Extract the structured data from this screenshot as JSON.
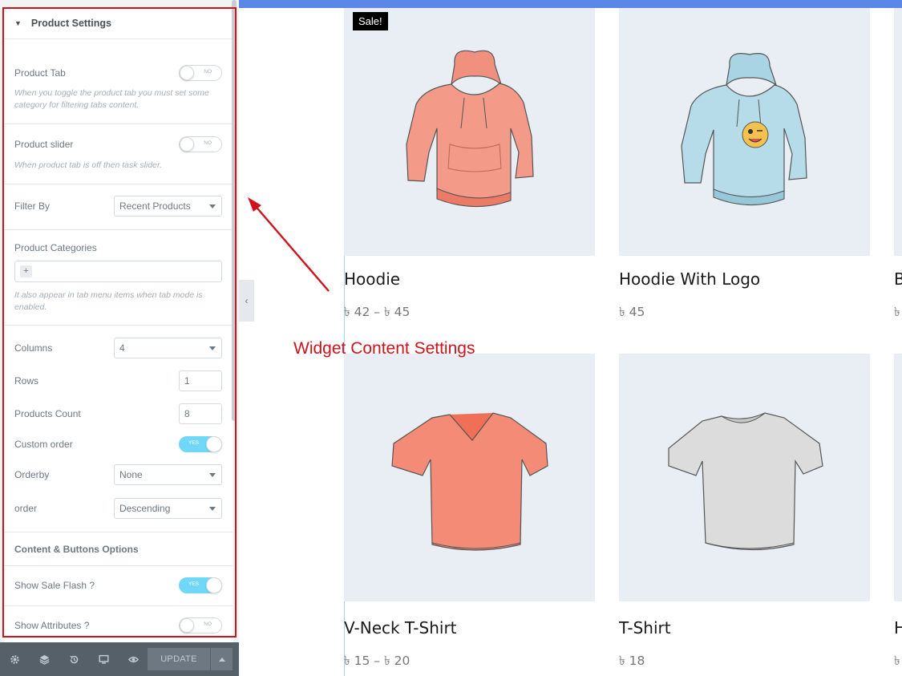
{
  "panel": {
    "section_title": "Product Settings",
    "product_tab": {
      "label": "Product Tab",
      "state": "NO",
      "desc": "When you toggle the product tab you must set some category for filtering tabs content."
    },
    "product_slider": {
      "label": "Product slider",
      "state": "NO",
      "desc": "When product tab is off then task slider."
    },
    "filter_by": {
      "label": "Filter By",
      "value": "Recent Products"
    },
    "product_categories": {
      "label": "Product Categories",
      "add": "+",
      "desc": "It also appear in tab menu items when tab mode is enabled."
    },
    "columns": {
      "label": "Columns",
      "value": "4"
    },
    "rows": {
      "label": "Rows",
      "value": "1"
    },
    "products_count": {
      "label": "Products Count",
      "value": "8"
    },
    "custom_order": {
      "label": "Custom order",
      "state": "YES"
    },
    "orderby": {
      "label": "Orderby",
      "value": "None"
    },
    "order": {
      "label": "order",
      "value": "Descending"
    },
    "content_buttons_title": "Content & Buttons Options",
    "show_sale_flash": {
      "label": "Show Sale Flash ?",
      "state": "YES"
    },
    "show_attributes": {
      "label": "Show Attributes ?",
      "state": "NO"
    }
  },
  "footer": {
    "icons": [
      "settings-icon",
      "layers-icon",
      "history-icon",
      "responsive-icon",
      "preview-icon"
    ],
    "update_label": "UPDATE"
  },
  "products": [
    {
      "name": "Hoodie",
      "price": "৳ 42 – ৳ 45",
      "sale_badge": "Sale!",
      "image": "salmon-hoodie"
    },
    {
      "name": "Hoodie With Logo",
      "price": "৳ 45",
      "image": "blue-hoodie-with-logo"
    },
    {
      "name": "V-Neck T-Shirt",
      "price": "৳ 15 – ৳ 20",
      "image": "salmon-vneck"
    },
    {
      "name": "T-Shirt",
      "price": "৳ 18",
      "image": "grey-tshirt"
    }
  ],
  "partial_products": [
    {
      "title_fragment": "B",
      "price_fragment": "৳"
    },
    {
      "title_fragment": "H",
      "price_fragment": "৳"
    }
  ],
  "annotation": "Widget Content Settings",
  "colors": {
    "annotation": "#d0121b",
    "toggle_on": "#71d7f7",
    "topbar": "#5b87e8"
  }
}
